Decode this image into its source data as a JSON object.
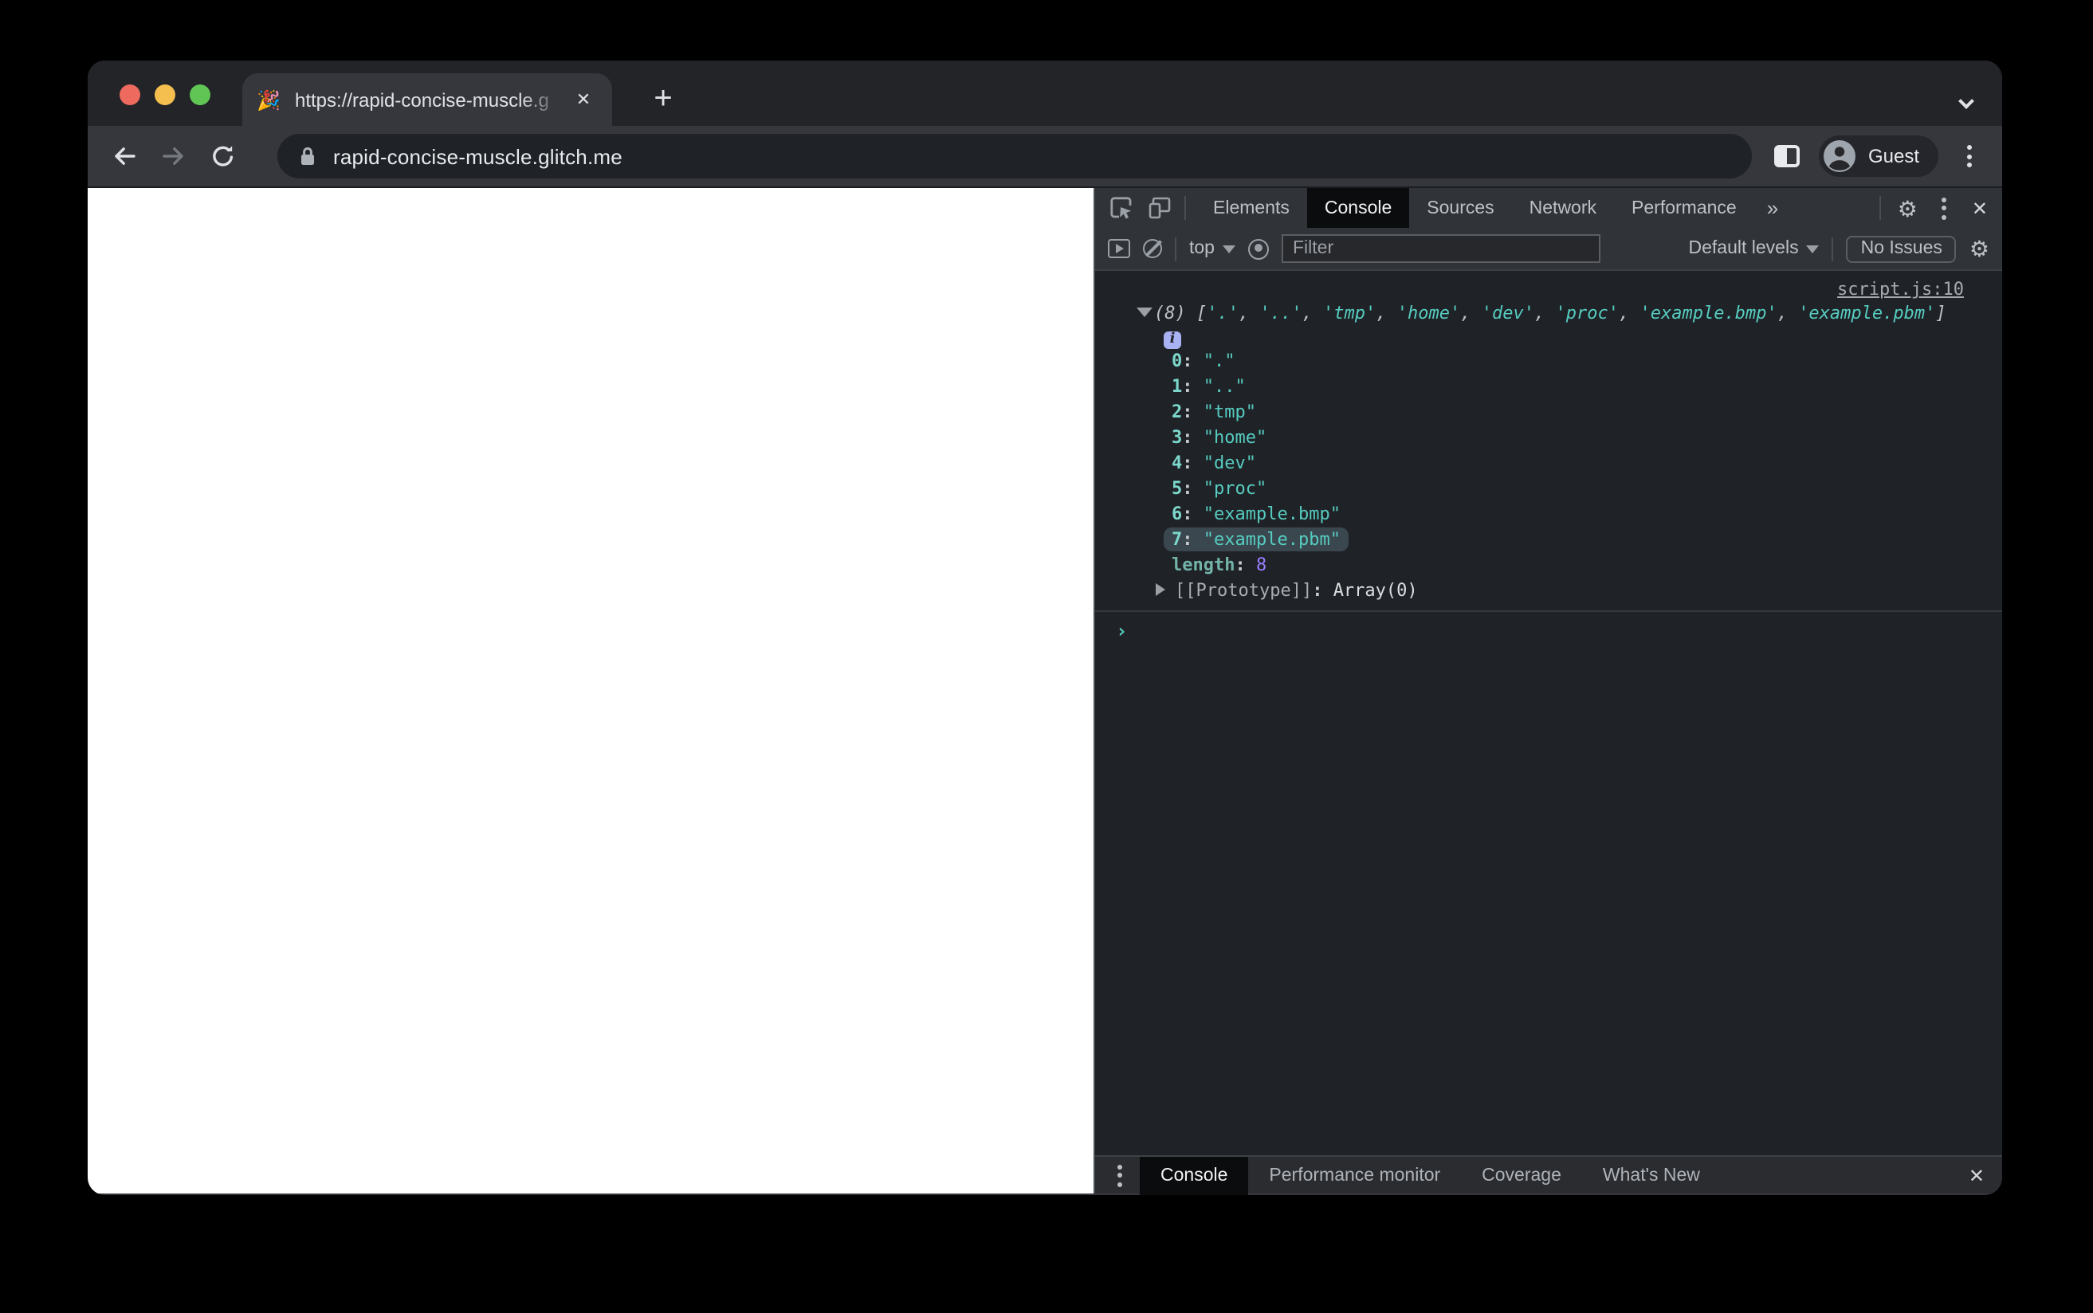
{
  "browser": {
    "tab_title": "https://rapid-concise-muscle.g",
    "favicon": "🎉",
    "new_tab_label": "+",
    "url": "rapid-concise-muscle.glitch.me",
    "profile_label": "Guest",
    "close_glyph": "✕"
  },
  "devtools": {
    "tabs": [
      "Elements",
      "Console",
      "Sources",
      "Network",
      "Performance"
    ],
    "active_tab": "Console",
    "more_tabs_glyph": "»",
    "gear_glyph": "⚙",
    "toolbar": {
      "context_label": "top",
      "filter_placeholder": "Filter",
      "levels_label": "Default levels",
      "issues_label": "No Issues"
    },
    "console": {
      "source_link": "script.js:10",
      "preview_count": "(8)",
      "values": [
        ".",
        "..",
        "tmp",
        "home",
        "dev",
        "proc",
        "example.bmp",
        "example.pbm"
      ],
      "highlighted_index": 7,
      "length_label": "length",
      "length_value": "8",
      "prototype_label": "[[Prototype]]",
      "prototype_value": "Array(0)",
      "prompt_glyph": "›"
    },
    "drawer": {
      "tabs": [
        "Console",
        "Performance monitor",
        "Coverage",
        "What's New"
      ],
      "active_tab": "Console",
      "close_glyph": "✕"
    }
  },
  "colors": {
    "string": "#56CCC0",
    "index": "#7CD8CC",
    "number": "#9980FF",
    "dim_text": "#9AA0A6",
    "highlight": "#3A474F",
    "info_badge": "#A9B2F2",
    "traffic_red": "#EE6A5F",
    "traffic_yellow": "#F5BF4F",
    "traffic_green": "#61C555",
    "page_bg": "#FFFFFF",
    "devtools_bg": "#1F2226",
    "bar_bg": "#303338"
  }
}
